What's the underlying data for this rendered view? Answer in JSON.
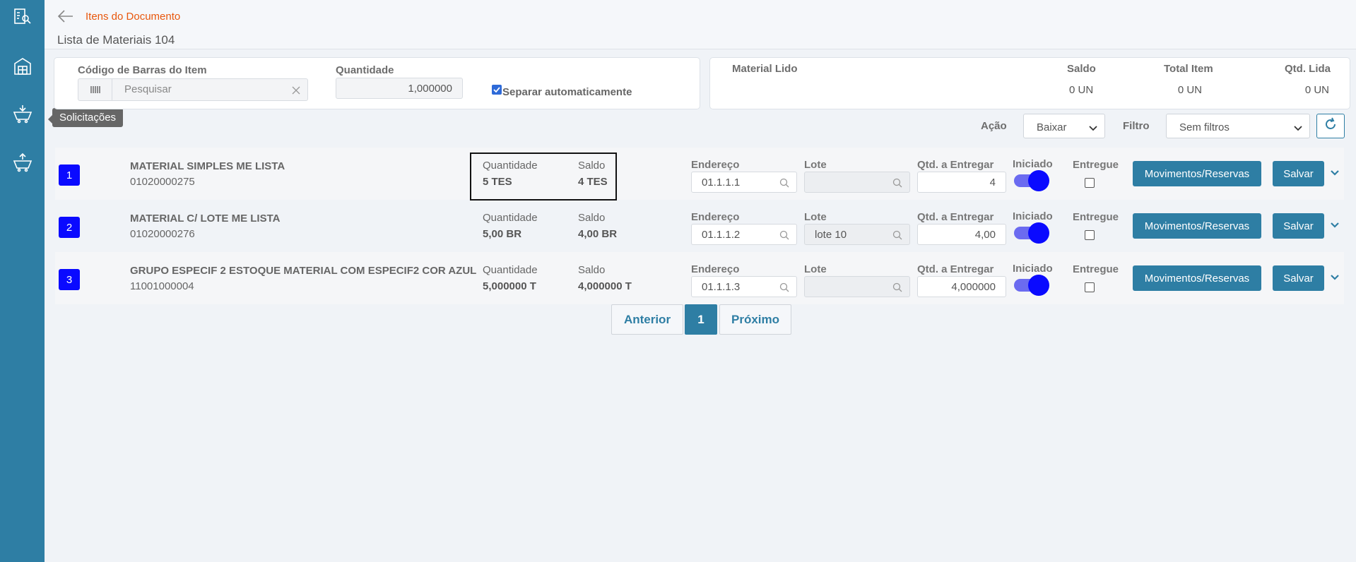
{
  "sidebar": {
    "items": [
      {
        "icon": "document-search-icon"
      },
      {
        "icon": "warehouse-icon"
      },
      {
        "icon": "basket-down-icon"
      },
      {
        "icon": "basket-up-icon"
      }
    ],
    "tooltip": "Solicitações"
  },
  "header": {
    "breadcrumb": "Itens do Documento",
    "title": "Lista de Materiais 104"
  },
  "scan": {
    "barcode_label": "Código de Barras do Item",
    "search_placeholder": "Pesquisar",
    "quantity_label": "Quantidade",
    "quantity_value": "1,000000",
    "auto_separate_label": "Separar automaticamente",
    "auto_separate_checked": true
  },
  "read_panel": {
    "material_label": "Material Lido",
    "saldo_label": "Saldo",
    "total_label": "Total Item",
    "qtd_label": "Qtd. Lida",
    "saldo_value": "0 UN",
    "total_value": "0 UN",
    "qtd_value": "0 UN"
  },
  "toolbar": {
    "action_label": "Ação",
    "action_value": "Baixar",
    "filter_label": "Filtro",
    "filter_value": "Sem filtros"
  },
  "columns": {
    "quantidade": "Quantidade",
    "saldo": "Saldo",
    "endereco": "Endereço",
    "lote": "Lote",
    "qtd_entregar": "Qtd. a Entregar",
    "iniciado": "Iniciado",
    "entregue": "Entregue",
    "movimentos_btn": "Movimentos/Reservas",
    "salvar_btn": "Salvar"
  },
  "rows": [
    {
      "num": "1",
      "name": "MATERIAL SIMPLES ME LISTA",
      "code": "01020000275",
      "quantidade": "5 TES",
      "saldo": "4 TES",
      "endereco": "01.1.1.1",
      "lote": "",
      "qtd_entregar": "4",
      "iniciado": true,
      "entregue": false
    },
    {
      "num": "2",
      "name": "MATERIAL C/ LOTE ME LISTA",
      "code": "01020000276",
      "quantidade": "5,00 BR",
      "saldo": "4,00 BR",
      "endereco": "01.1.1.2",
      "lote": "lote 10",
      "qtd_entregar": "4,00",
      "iniciado": true,
      "entregue": false
    },
    {
      "num": "3",
      "name": "GRUPO ESPECIF 2 ESTOQUE MATERIAL COM ESPECIF2 COR AZUL",
      "code": "11001000004",
      "quantidade": "5,000000 T",
      "saldo": "4,000000 T",
      "endereco": "01.1.1.3",
      "lote": "",
      "qtd_entregar": "4,000000",
      "iniciado": true,
      "entregue": false
    }
  ],
  "pagination": {
    "prev": "Anterior",
    "current": "1",
    "next": "Próximo"
  }
}
